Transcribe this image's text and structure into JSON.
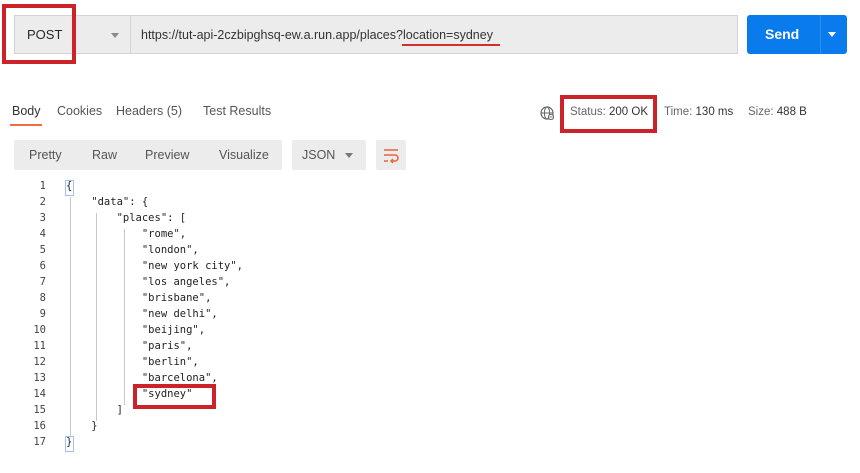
{
  "request": {
    "method": "POST",
    "url": "https://tut-api-2czbipghsq-ew.a.run.app/places?location=sydney",
    "send_label": "Send"
  },
  "response_tabs": [
    {
      "label": "Body",
      "active": true
    },
    {
      "label": "Cookies",
      "active": false
    },
    {
      "label": "Headers (5)",
      "active": false
    },
    {
      "label": "Test Results",
      "active": false
    }
  ],
  "status": {
    "status_label": "Status:",
    "status_value": "200 OK",
    "time_label": "Time:",
    "time_value": "130 ms",
    "size_label": "Size:",
    "size_value": "488 B"
  },
  "view_modes": [
    "Pretty",
    "Raw",
    "Preview",
    "Visualize"
  ],
  "format": "JSON",
  "code_lines": [
    {
      "num": "1",
      "text": "{"
    },
    {
      "num": "2",
      "text": "    \"data\": {"
    },
    {
      "num": "3",
      "text": "        \"places\": ["
    },
    {
      "num": "4",
      "text": "            \"rome\","
    },
    {
      "num": "5",
      "text": "            \"london\","
    },
    {
      "num": "6",
      "text": "            \"new york city\","
    },
    {
      "num": "7",
      "text": "            \"los angeles\","
    },
    {
      "num": "8",
      "text": "            \"brisbane\","
    },
    {
      "num": "9",
      "text": "            \"new delhi\","
    },
    {
      "num": "10",
      "text": "            \"beijing\","
    },
    {
      "num": "11",
      "text": "            \"paris\","
    },
    {
      "num": "12",
      "text": "            \"berlin\","
    },
    {
      "num": "13",
      "text": "            \"barcelona\","
    },
    {
      "num": "14",
      "text": "            \"sydney\""
    },
    {
      "num": "15",
      "text": "        ]"
    },
    {
      "num": "16",
      "text": "    }"
    },
    {
      "num": "17",
      "text": "}"
    }
  ],
  "colors": {
    "send_button": "#097bed",
    "highlight": "#cc2229",
    "active_tab_underline": "#f26b3a",
    "wrap_icon": "#e8643a"
  },
  "icons": [
    "chevron-down-icon",
    "globe-icon",
    "wrap-lines-icon"
  ]
}
